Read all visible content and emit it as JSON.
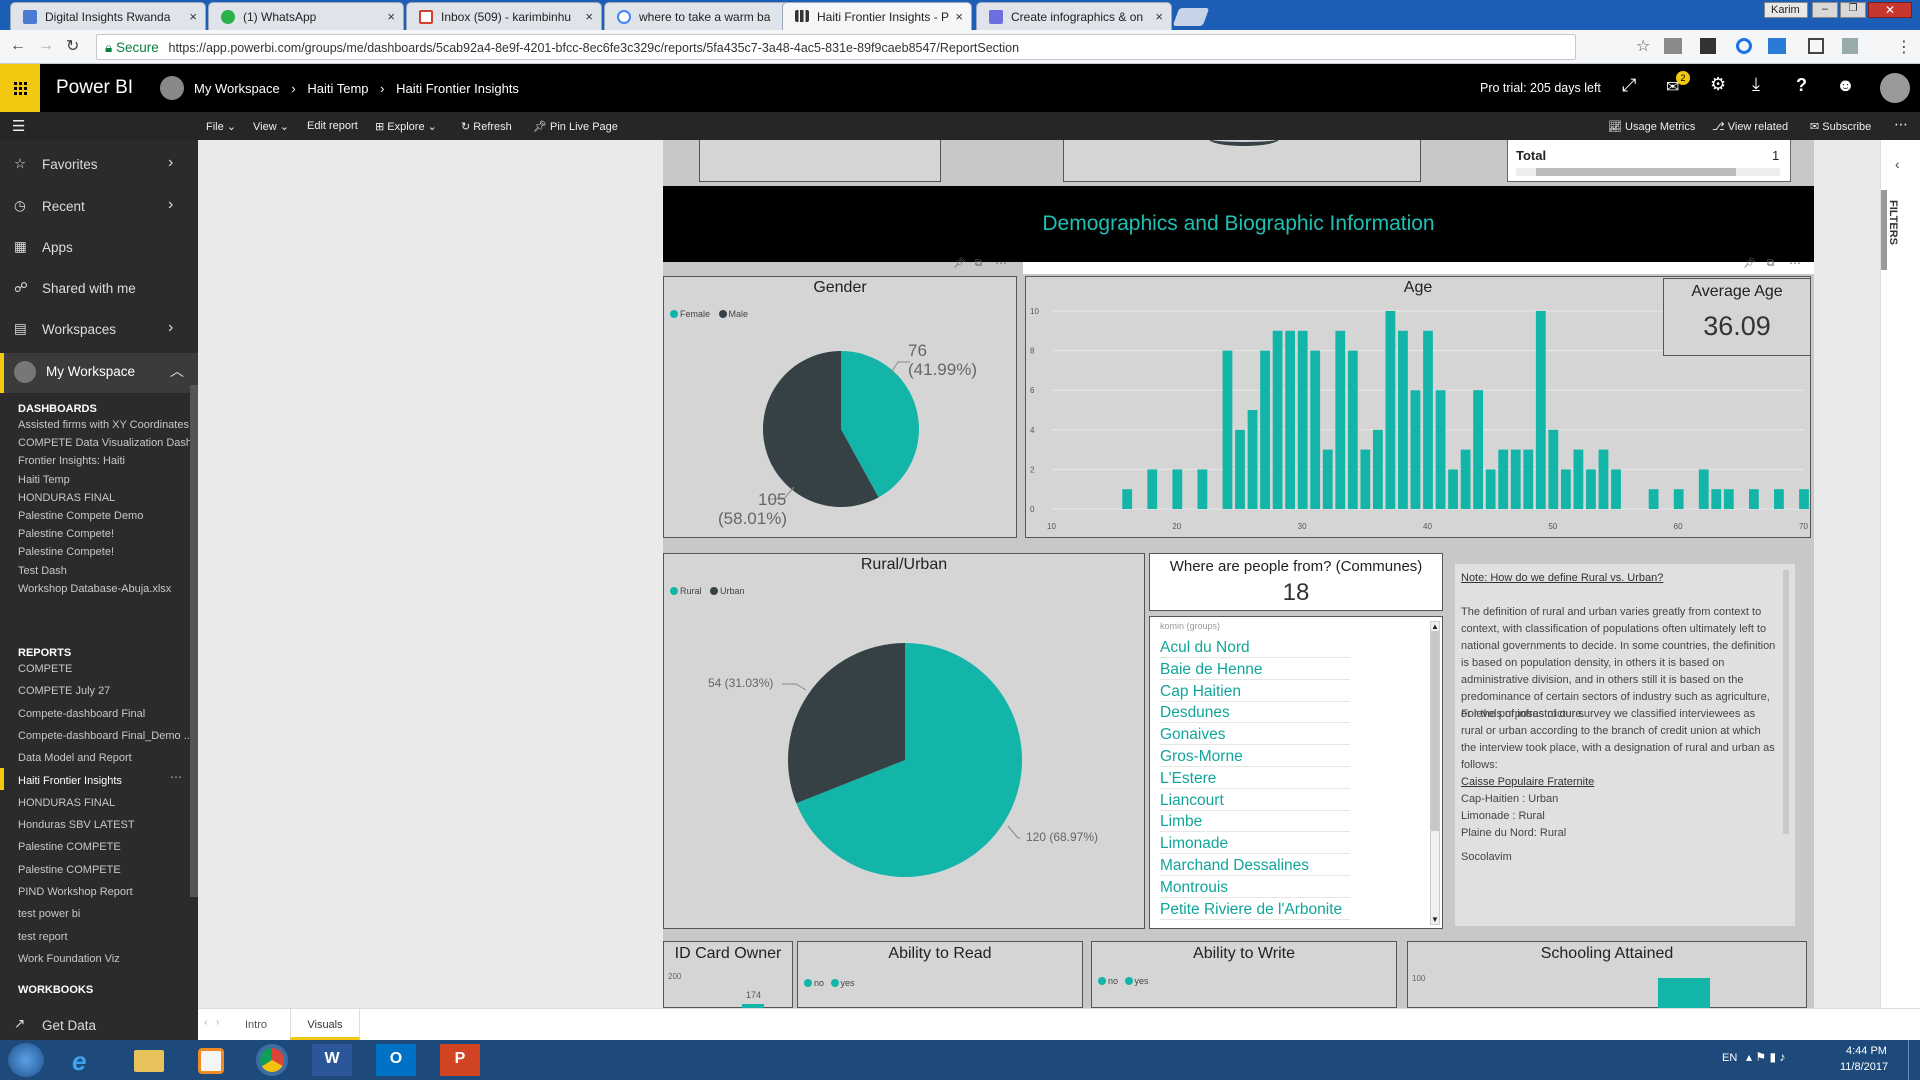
{
  "browser": {
    "tabs": [
      {
        "label": "Digital Insights Rwanda",
        "color": "#4a7bd0"
      },
      {
        "label": "(1) WhatsApp",
        "color": "#2bb14a"
      },
      {
        "label": "Inbox (509) - karimbinhu",
        "color": "#d23f31"
      },
      {
        "label": "where to take a warm ba",
        "color": "#4285f4"
      },
      {
        "label": "Haiti Frontier Insights - P",
        "color": "#f2c811"
      },
      {
        "label": "Create infographics & on",
        "color": "#6e6ee0"
      }
    ],
    "user": "Karim",
    "secure_label": "Secure",
    "url": "https://app.powerbi.com/groups/me/dashboards/5cab92a4-8e9f-4201-bfcc-8ec6fe3c329c/reports/5fa435c7-3a48-4ac5-831e-89f9caeb8547/ReportSection"
  },
  "header": {
    "app_name": "Power BI",
    "breadcrumb": [
      "My Workspace",
      "Haiti Temp",
      "Haiti Frontier Insights"
    ],
    "trial": "Pro trial: 205 days left",
    "notif_count": "2"
  },
  "commandbar": {
    "file": "File",
    "view": "View",
    "edit": "Edit report",
    "explore": "Explore",
    "refresh": "Refresh",
    "pin": "Pin Live Page",
    "usage": "Usage Metrics",
    "related": "View related",
    "subscribe": "Subscribe"
  },
  "nav": {
    "items": [
      "Favorites",
      "Recent",
      "Apps",
      "Shared with me",
      "Workspaces",
      "My Workspace"
    ],
    "dashboards_label": "DASHBOARDS",
    "dashboards": [
      "Assisted firms with XY Coordinates...",
      "COMPETE Data Visualization Dash...",
      "Frontier Insights: Haiti",
      "Haiti Temp",
      "HONDURAS FINAL",
      "Palestine Compete Demo",
      "Palestine Compete!",
      "Palestine Compete!",
      "Test Dash",
      "Workshop Database-Abuja.xlsx"
    ],
    "reports_label": "REPORTS",
    "reports": [
      "COMPETE",
      "COMPETE July 27",
      "Compete-dashboard Final",
      "Compete-dashboard Final_Demo ...",
      "Data Model and Report",
      "Haiti Frontier Insights",
      "HONDURAS FINAL",
      "Honduras SBV LATEST",
      "Palestine COMPETE",
      "Palestine COMPETE",
      "PIND Workshop Report",
      "test power bi",
      "test report",
      "Work Foundation Viz"
    ],
    "workbooks_label": "WORKBOOKS",
    "get_data": "Get Data"
  },
  "report": {
    "total_label": "Total",
    "total_value": "1",
    "section_title": "Demographics and Biographic Information",
    "gender": {
      "title": "Gender",
      "legend": [
        "Female",
        "Male"
      ],
      "female_count": "76",
      "female_pct": "(41.99%)",
      "male_count": "105",
      "male_pct": "(58.01%)"
    },
    "age": {
      "title": "Age"
    },
    "avg_age": {
      "label": "Average Age",
      "value": "36.09"
    },
    "rural": {
      "title": "Rural/Urban",
      "legend": [
        "Rural",
        "Urban"
      ],
      "urban_label": "54 (31.03%)",
      "rural_label": "120 (68.97%)"
    },
    "communes": {
      "title": "Where are people from? (Communes)",
      "count": "18",
      "list_header": "komin (groups)",
      "items": [
        "Acul du Nord",
        "Baie de Henne",
        "Cap Haitien",
        "Desdunes",
        "Gonaives",
        "Gros-Morne",
        "L'Estere",
        "Liancourt",
        "Limbe",
        "Limonade",
        "Marchand Dessalines",
        "Montrouis",
        "Petite Riviere de l'Arbonite"
      ]
    },
    "note": {
      "heading": "Note: How do we define Rural vs. Urban?",
      "p1": "The definition of rural and urban varies greatly from context to context, with classification of populations often ultimately left to national governments to decide. In some countries, the definition is based on population density, in others it is based on administrative division, and in others still it is based on the predominance of certain sectors of industry such as agriculture, or levels of infrastructure.",
      "p2": "For the purposes of our survey we classified interviewees as rural or urban according to the branch of credit union at which the interview took place, with a designation of rural and urban as follows:",
      "sub": "Caisse Populaire Fraternite",
      "lines": [
        "Cap-Haitien : Urban",
        "Limonade : Rural",
        "Plaine du Nord: Rural"
      ],
      "cut": "Socolavim"
    },
    "idcard": {
      "title": "ID Card Owner",
      "tick": "200",
      "value": "174"
    },
    "read": {
      "title": "Ability to Read",
      "legend": [
        "no",
        "yes"
      ]
    },
    "write": {
      "title": "Ability to Write",
      "legend": [
        "no",
        "yes"
      ]
    },
    "school": {
      "title": "Schooling Attained",
      "tick": "100"
    }
  },
  "pages": [
    "Intro",
    "Visuals"
  ],
  "filters_label": "FILTERS",
  "taskbar": {
    "lang": "EN",
    "time": "4:44 PM",
    "date": "11/8/2017"
  },
  "colors": {
    "teal": "#12b5a8",
    "dark": "#354145",
    "pbi_yellow": "#f2c811"
  },
  "chart_data": [
    {
      "type": "pie",
      "title": "Gender",
      "labels": [
        "Female",
        "Male"
      ],
      "values": [
        76,
        105
      ]
    },
    {
      "type": "bar",
      "title": "Age",
      "xlim": [
        10,
        70
      ],
      "ylim": [
        0,
        10
      ],
      "x": [
        16,
        18,
        20,
        22,
        24,
        25,
        26,
        27,
        28,
        29,
        30,
        31,
        32,
        33,
        34,
        35,
        36,
        37,
        38,
        39,
        40,
        41,
        42,
        43,
        44,
        45,
        46,
        47,
        48,
        49,
        50,
        51,
        52,
        53,
        54,
        55,
        58,
        60,
        62,
        63,
        64,
        66,
        68,
        70
      ],
      "values": [
        1,
        2,
        2,
        2,
        8,
        4,
        5,
        8,
        9,
        9,
        9,
        8,
        3,
        9,
        8,
        3,
        4,
        10,
        9,
        6,
        9,
        6,
        2,
        3,
        6,
        2,
        3,
        3,
        3,
        10,
        4,
        2,
        3,
        2,
        3,
        2,
        1,
        1,
        2,
        1,
        1,
        1,
        1,
        1
      ]
    },
    {
      "type": "pie",
      "title": "Rural/Urban",
      "labels": [
        "Rural",
        "Urban"
      ],
      "values": [
        120,
        54
      ]
    }
  ]
}
